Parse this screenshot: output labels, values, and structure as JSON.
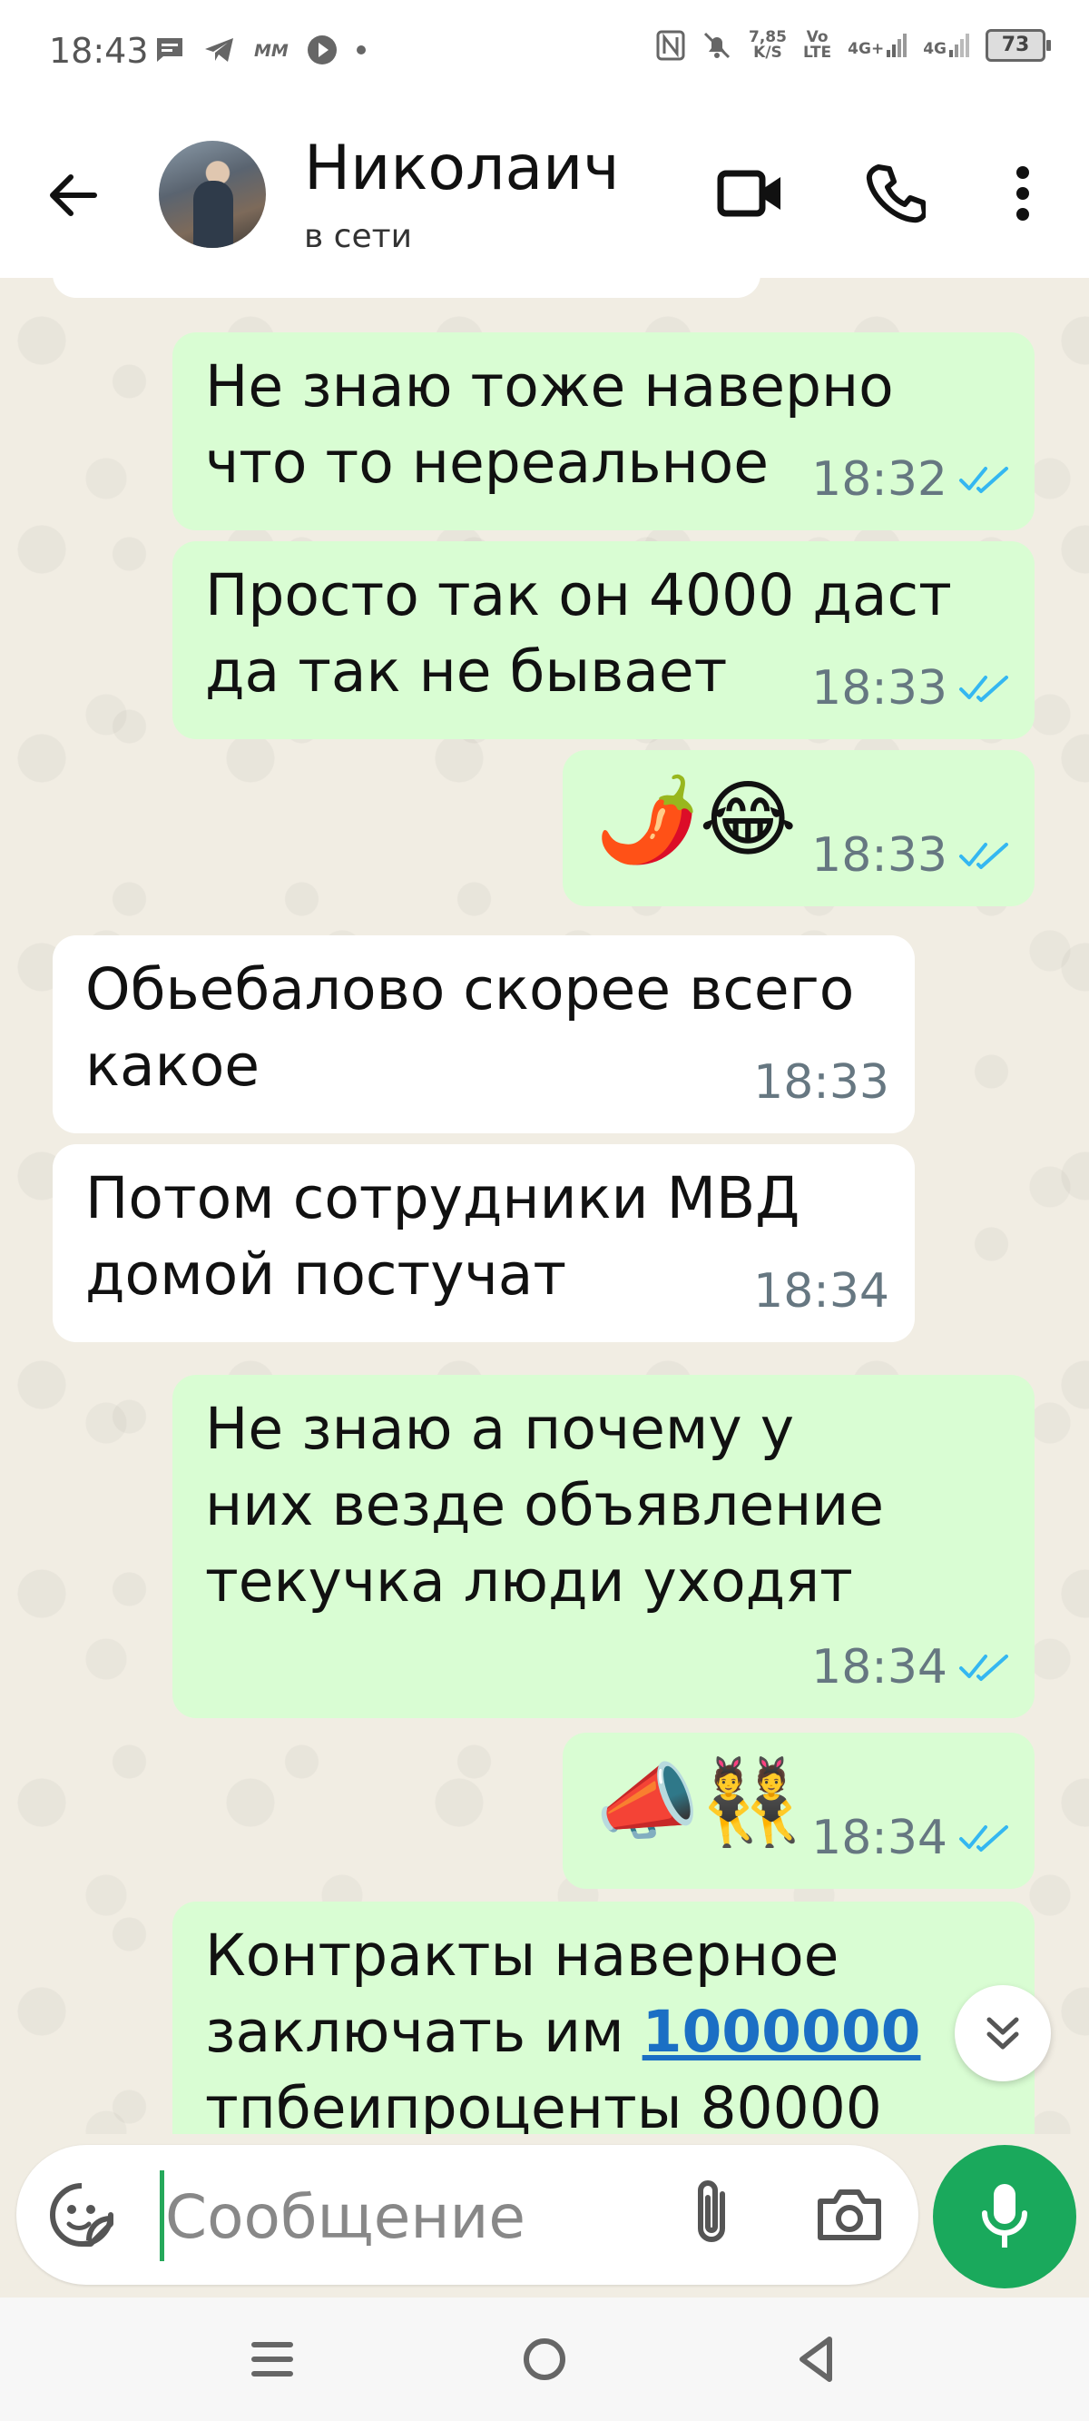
{
  "status_bar": {
    "time": "18:43",
    "net_speed": "7,85",
    "net_unit": "K/S",
    "volte": "Vo",
    "lte": "LTE",
    "sim1": "4G+",
    "sim2": "4G",
    "battery": "73"
  },
  "header": {
    "contact_name": "Николаич",
    "status": "в сети"
  },
  "messages": [
    {
      "dir": "out",
      "text": "Не знаю тоже наверно\nчто то нереальное",
      "time": "18:32"
    },
    {
      "dir": "out",
      "text": "Просто так он 4000 даст\nда так не бывает",
      "time": "18:33"
    },
    {
      "dir": "out",
      "text": "🌶️😂",
      "time": "18:33"
    },
    {
      "dir": "in",
      "text": "Обьебалово скорее всего\nкакое",
      "time": "18:33"
    },
    {
      "dir": "in",
      "text": "Потом сотрудники МВД\nдомой постучат",
      "time": "18:34"
    },
    {
      "dir": "out",
      "text": "Не знаю а почему у\nних везде объявление\nтекучка люди уходят",
      "time": "18:34"
    },
    {
      "dir": "out",
      "text": "📣👯",
      "time": "18:34"
    },
    {
      "dir": "out",
      "text_before": "Контракты наверное\nзаключать им ",
      "link": "1000000",
      "text_after": "\nтпбеипроценты 80000"
    }
  ],
  "composer": {
    "placeholder": "Сообщение"
  },
  "colors": {
    "outgoing_bubble": "#d9fdd3",
    "incoming_bubble": "#ffffff",
    "accent": "#1aa95c",
    "read_ticks": "#34b7f1"
  }
}
